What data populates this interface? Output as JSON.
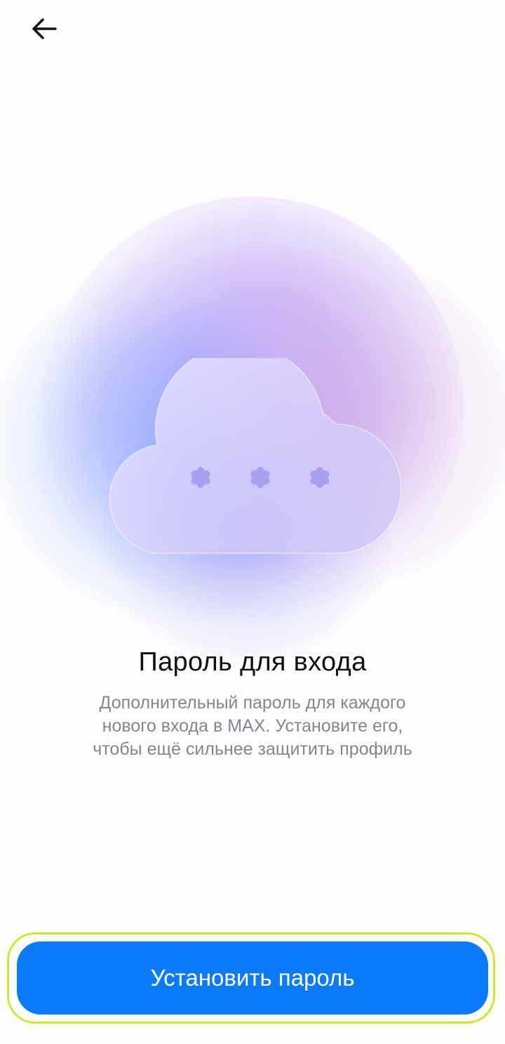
{
  "header": {
    "back_icon": "arrow-left-icon"
  },
  "illustration": {
    "icon": "cloud-password-icon",
    "mask_symbols": 3
  },
  "content": {
    "title": "Пароль для входа",
    "description_lines": [
      "Дополнительный пароль для каждого",
      "нового входа в MAX. Установите его,",
      "чтобы ещё сильнее защитить профиль"
    ]
  },
  "actions": {
    "primary_label": "Установить пароль",
    "primary_color": "#0a7afc"
  }
}
